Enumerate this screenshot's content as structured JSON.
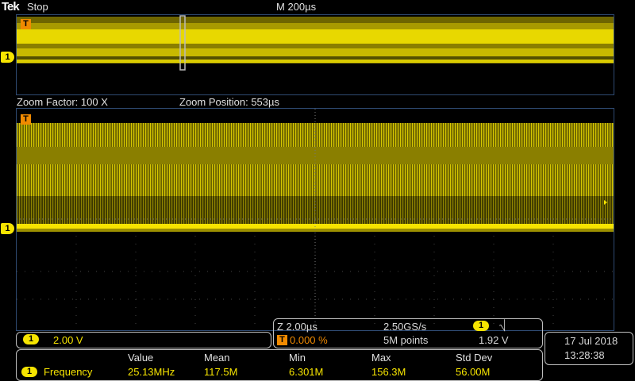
{
  "header": {
    "logo": "Tek",
    "status": "Stop",
    "timebase": "M 200µs"
  },
  "zoom": {
    "factor_label": "Zoom Factor: 100 X",
    "position_label": "Zoom Position: 553µs"
  },
  "markers": {
    "trigger": "T",
    "channel": "1"
  },
  "channel_box": {
    "chip": "1",
    "scale": "2.00 V"
  },
  "acq_box": {
    "zoom_scale": "Z 2.00µs",
    "sample_rate": "2.50GS/s",
    "trigger_chip": "1",
    "trigger_slope": "⎷",
    "trigger_pos_icon": "T",
    "trigger_pos": "0.000 %",
    "record_length": "5M points",
    "trigger_level": "1.92 V"
  },
  "datetime": {
    "date": "17 Jul  2018",
    "time": "13:28:38"
  },
  "measurements": {
    "headers": [
      "Value",
      "Mean",
      "Min",
      "Max",
      "Std Dev"
    ],
    "rows": [
      {
        "chip": "1",
        "name": "Frequency",
        "values": [
          "25.13MHz",
          "117.5M",
          "6.301M",
          "156.3M",
          "56.00M"
        ]
      }
    ]
  },
  "colors": {
    "channel1": "#f6e400",
    "trigger": "#f08a00",
    "grid_border": "#2f4b73",
    "background": "#000000"
  }
}
